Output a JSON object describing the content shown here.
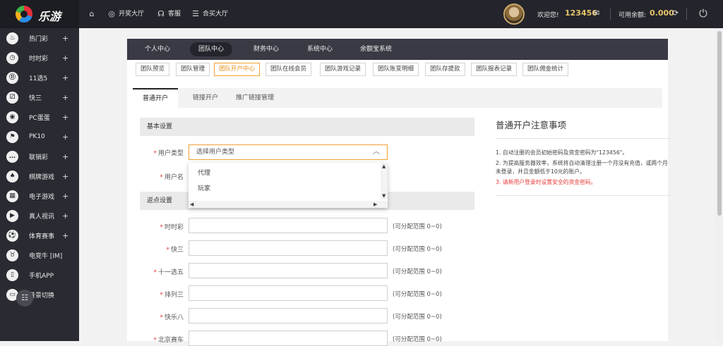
{
  "app": {
    "logo_text": "乐游"
  },
  "topnav": {
    "items": [
      {
        "label": "",
        "icon": "home-icon"
      },
      {
        "label": "开奖大厅",
        "icon": "lottery-icon"
      },
      {
        "label": "客服",
        "icon": "headset-icon"
      },
      {
        "label": "合买大厅",
        "icon": "list-icon"
      }
    ]
  },
  "user": {
    "welcome": "欢迎您!",
    "name": "123456",
    "balance_label": "可用余额:",
    "balance": "0.000"
  },
  "sidebar": {
    "items": [
      {
        "label": "热门彩",
        "icon": "hot-lottery-icon",
        "glyph": "♨",
        "plus": "+"
      },
      {
        "label": "时时彩",
        "icon": "ssc-icon",
        "glyph": "◷",
        "plus": "+"
      },
      {
        "label": "11选5",
        "icon": "11x5-icon",
        "glyph": "⑪",
        "plus": "+"
      },
      {
        "label": "快三",
        "icon": "dice-icon",
        "glyph": "⚂",
        "plus": "+"
      },
      {
        "label": "PC蛋蛋",
        "icon": "pc-egg-icon",
        "glyph": "◉",
        "plus": "+"
      },
      {
        "label": "PK10",
        "icon": "pk10-icon",
        "glyph": "⚑",
        "plus": "+"
      },
      {
        "label": "联销彩",
        "icon": "chat-icon",
        "glyph": "…",
        "plus": "+"
      },
      {
        "label": "棋牌游戏",
        "icon": "cards-icon",
        "glyph": "♠",
        "plus": "+"
      },
      {
        "label": "电子游戏",
        "icon": "slot-icon",
        "glyph": "▦",
        "plus": "+"
      },
      {
        "label": "真人视讯",
        "icon": "live-video-icon",
        "glyph": "▶",
        "plus": "+"
      },
      {
        "label": "体育赛事",
        "icon": "soccer-icon",
        "glyph": "⚽",
        "plus": "+"
      },
      {
        "label": "电竞牛 [IM]",
        "icon": "esports-icon",
        "glyph": "♉",
        "plus": ""
      },
      {
        "label": "手机APP",
        "icon": "phone-icon",
        "glyph": "▯",
        "plus": ""
      },
      {
        "label": "背景切换",
        "icon": "monitor-icon",
        "glyph": "▭",
        "plus": ""
      }
    ]
  },
  "tabs_primary": [
    "个人中心",
    "团队中心",
    "财务中心",
    "系统中心",
    "余额宝系统"
  ],
  "tabs_secondary": [
    "团队预览",
    "团队管理",
    "团队开户中心",
    "团队在线会员",
    "团队游戏记录",
    "团队账变明细",
    "团队存提款",
    "团队报表记录",
    "团队佣金统计"
  ],
  "tabs_tertiary": [
    "普通开户",
    "链接开户",
    "推广链接管理"
  ],
  "form": {
    "basic_heading": "基本设置",
    "user_type_label": "用户类型",
    "user_type_placeholder": "选择用户类型",
    "username_label": "用户名",
    "options": [
      "代理",
      "玩家"
    ],
    "rebate_heading": "返点设置",
    "rebate_rows": [
      {
        "label": "时时彩",
        "range": "(可分配范围 0~0)"
      },
      {
        "label": "快三",
        "range": "(可分配范围 0~0)"
      },
      {
        "label": "十一选五",
        "range": "(可分配范围 0~0)"
      },
      {
        "label": "排列三",
        "range": "(可分配范围 0~0)"
      },
      {
        "label": "快乐八",
        "range": "(可分配范围 0~0)"
      },
      {
        "label": "北京赛车",
        "range": "(可分配范围 0~0)"
      }
    ],
    "required_mark": "*"
  },
  "notes": {
    "title": "普通开户注意事项",
    "items": [
      "1. 自动注册的会员初始密码及资金密码为\"123456\"。",
      "2. 为提高服务器效率，系统将自动清理注册一个月没有充值，或两个月未登录，并且金额低于10元的账户。",
      "3. 请新用户登录时设置安全的资金密码。"
    ]
  }
}
